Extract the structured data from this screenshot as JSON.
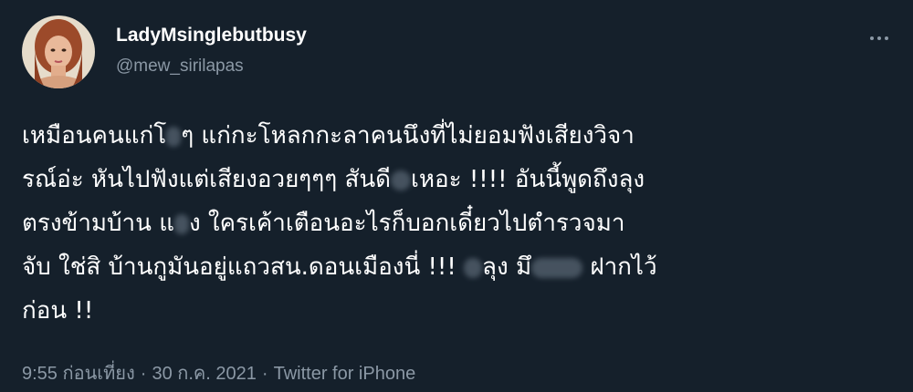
{
  "user": {
    "display_name": "LadyMsinglebutbusy",
    "handle": "@mew_sirilapas"
  },
  "tweet": {
    "line1a": "เหมือนคนแก่โ",
    "line1b": "ๆ แก่กะโหลกกะลาคนนึงที่ไม่ยอมฟังเสียงวิจา",
    "line2a": "รณ์อ่ะ หันไปฟังแต่เสียงอวยๆๆๆ สันดี",
    "line2b": "เหอะ !!!! อันนี้พูดถึงลุง",
    "line3a": "ตรงข้ามบ้าน แ",
    "line3b": "ง ใครเค้าเตือนอะไรก็บอกเดี๋ยวไปตำรวจมา",
    "line4a": "จับ ใช่สิ บ้านกูมันอยู่แถวสน.ดอนเมืองนี่ !!! ",
    "line4b": "ลุง มึ",
    "line4c": " ฝากไว้",
    "line5": "ก่อน !!"
  },
  "meta": {
    "time": "9:55 ก่อนเที่ยง",
    "date": "30 ก.ค. 2021",
    "source": "Twitter for iPhone",
    "separator": "·"
  },
  "icons": {
    "more": "more-horizontal-icon"
  },
  "colors": {
    "background": "#15202b",
    "text": "#ffffff",
    "secondary": "#8b98a5"
  }
}
